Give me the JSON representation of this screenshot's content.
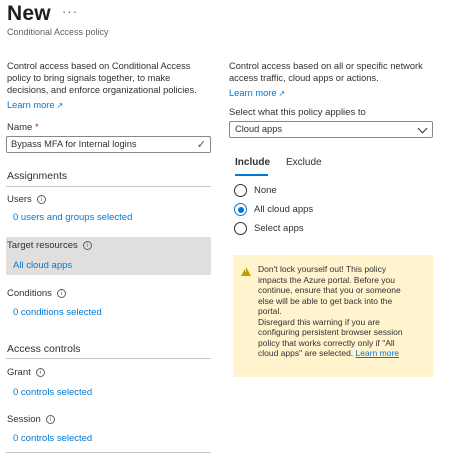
{
  "header": {
    "title": "New",
    "more_label": "···",
    "subtitle": "Conditional Access policy"
  },
  "left": {
    "description_lines": [
      "Control access based on Conditional Access",
      "policy to bring signals together, to make",
      "decisions, and enforce organizational policies."
    ],
    "learn_more": "Learn more",
    "name_label": "Name",
    "name_required": "*",
    "name_value": "Bypass MFA for Internal logins",
    "assignments_heading": "Assignments",
    "users_label": "Users",
    "users_value": "0 users and groups selected",
    "target_label": "Target resources",
    "target_value": "All cloud apps",
    "conditions_label": "Conditions",
    "conditions_value": "0 conditions selected",
    "access_controls_heading": "Access controls",
    "grant_label": "Grant",
    "grant_value": "0 controls selected",
    "session_label": "Session",
    "session_value": "0 controls selected"
  },
  "right": {
    "description_lines": [
      "Control access based on all or specific network",
      "access traffic, cloud apps or actions."
    ],
    "learn_more": "Learn more",
    "applies_label": "Select what this policy applies to",
    "applies_value": "Cloud apps",
    "tabs": [
      "Include",
      "Exclude"
    ],
    "radios": [
      "None",
      "All cloud apps",
      "Select apps"
    ],
    "selected_radio": "All cloud apps",
    "warning_lines": [
      "Don't lock yourself out! This policy",
      "impacts the Azure portal. Before you",
      "continue, ensure that you or someone",
      "else will be able to get back into the",
      "portal.",
      "Disregard this warning if you are",
      "configuring persistent browser session",
      "policy that works correctly only if \"All",
      "cloud apps\" are selected."
    ],
    "warning_link": "Learn more"
  },
  "colors": {
    "accent": "#0078d4",
    "warning_bg": "#fff4ce",
    "highlight_bg": "#e1dfdd",
    "valid_check": "#107c10"
  },
  "icons": [
    "more-icon",
    "external-link-icon",
    "checkmark-icon",
    "info-icon",
    "chevron-down-icon",
    "warning-icon"
  ]
}
